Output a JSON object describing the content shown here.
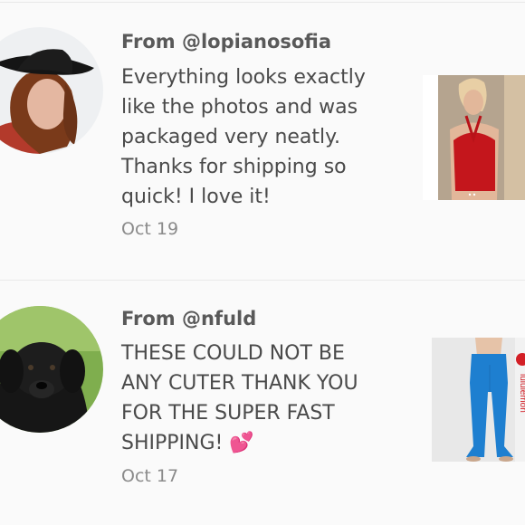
{
  "reviews": [
    {
      "from": "From @lopianosofia",
      "body_lines": [
        "Everything looks exactly",
        "like the photos and was",
        "packaged very neatly.",
        "Thanks for shipping so",
        "quick! I love it!"
      ],
      "date": "Oct 19",
      "avatar_icon": "avatar-woman-black-hat-icon",
      "product_icon": "red-halter-top-photo"
    },
    {
      "from": "From @nfuld",
      "body_lines": [
        "THESE COULD NOT BE",
        "ANY CUTER THANK YOU",
        "FOR THE SUPER FAST",
        "SHIPPING! 💕"
      ],
      "date": "Oct 17",
      "avatar_icon": "avatar-black-puppy-icon",
      "product_icon": "blue-flare-leggings-photo",
      "product_brand": "lululemon"
    }
  ]
}
